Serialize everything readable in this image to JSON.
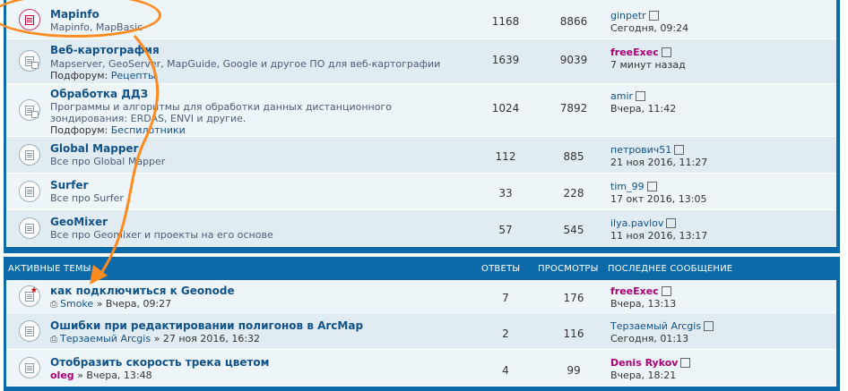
{
  "forums": [
    {
      "title": "Mapinfo",
      "desc": "Mapinfo, MapBasic",
      "subforum": null,
      "topics": "1168",
      "posts": "8866",
      "last_user": "ginpetr",
      "last_user_pink": false,
      "last_date": "Сегодня, 09:24",
      "icon": "red"
    },
    {
      "title": "Веб-картография",
      "desc": "Mapserver, GeoServer, MapGuide, Google и другое ПО для веб-картографии",
      "subforum_label": "Подфорум:",
      "subforum": "Рецепты",
      "topics": "1639",
      "posts": "9039",
      "last_user": "freeExec",
      "last_user_pink": true,
      "last_date": "7 минут назад",
      "icon": "sub"
    },
    {
      "title": "Обработка ДДЗ",
      "desc": "Программы и алгоритмы для обработки данных дистанционного",
      "desc2": "зондирования: ERDAS, ENVI и другие.",
      "subforum_label": "Подфорум:",
      "subforum": "Беспилотники",
      "topics": "1024",
      "posts": "7892",
      "last_user": "amir",
      "last_user_pink": false,
      "last_date": "Вчера, 11:42",
      "icon": "sub"
    },
    {
      "title": "Global Mapper",
      "desc": "Все про Global Mapper",
      "subforum": null,
      "topics": "112",
      "posts": "885",
      "last_user": "петрович51",
      "last_user_pink": false,
      "last_date": "21 ноя 2016, 11:27",
      "icon": "plain"
    },
    {
      "title": "Surfer",
      "desc": "Все про Surfer",
      "subforum": null,
      "topics": "33",
      "posts": "228",
      "last_user": "tim_99",
      "last_user_pink": false,
      "last_date": "17 окт 2016, 13:05",
      "icon": "plain"
    },
    {
      "title": "GeoMixer",
      "desc": "Все про Geomixer и проекты на его основе",
      "subforum": null,
      "topics": "57",
      "posts": "545",
      "last_user": "ilya.pavlov",
      "last_user_pink": false,
      "last_date": "11 ноя 2016, 13:17",
      "icon": "plain"
    }
  ],
  "active_header": {
    "title": "АКТИВНЫЕ ТЕМЫ",
    "replies": "ОТВЕТЫ",
    "views": "ПРОСМОТРЫ",
    "last": "ПОСЛЕДНЕЕ СООБЩЕНИЕ"
  },
  "topics": [
    {
      "title": "как подключиться к Geonode",
      "author": "Smoke",
      "author_pink": false,
      "date": "» Вчера, 09:27",
      "replies": "7",
      "views": "176",
      "last_user": "freeExec",
      "last_user_pink": true,
      "last_date": "Вчера, 13:13",
      "star": true
    },
    {
      "title": "Ошибки при редактировании полигонов в ArcMap",
      "author": "Терзаемый Arcgis",
      "author_pink": false,
      "date": "» 27 ноя 2016, 16:32",
      "replies": "2",
      "views": "116",
      "last_user": "Терзаемый Arcgis",
      "last_user_pink": false,
      "last_date": "Сегодня, 01:13",
      "star": false
    },
    {
      "title": "Отобразить скорость трека цветом",
      "author": "oleg",
      "author_pink": true,
      "date": "» Вчера, 13:48",
      "replies": "4",
      "views": "99",
      "last_user": "Denis Rykov",
      "last_user_pink": true,
      "last_date": "Вчера, 18:21",
      "star": false
    }
  ],
  "colors": {
    "header_blue": "#0c6aa8",
    "link": "#105289",
    "pink": "#aa0077",
    "annotation": "#ff8a1e"
  }
}
